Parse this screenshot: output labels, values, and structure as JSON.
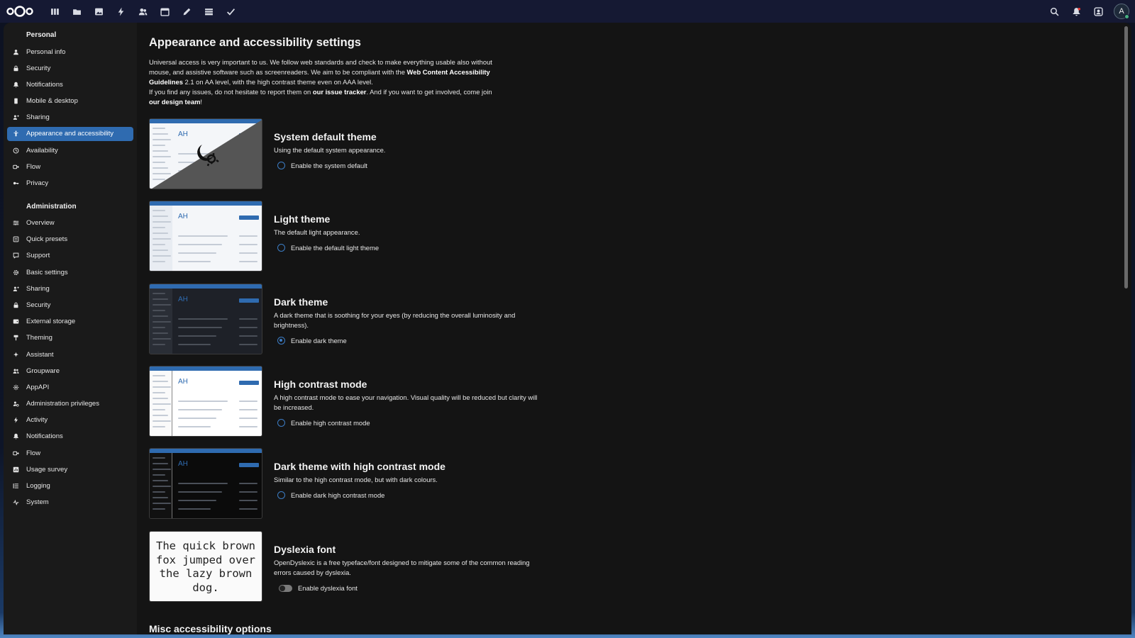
{
  "header": {
    "apps": [
      "dashboard-icon",
      "files-icon",
      "photos-icon",
      "activity-icon",
      "contacts-icon",
      "calendar-icon",
      "notes-icon",
      "deck-icon",
      "tasks-icon"
    ],
    "right_icons": [
      "search-icon",
      "notifications-icon",
      "contacts-menu-icon"
    ],
    "avatar_initial": "A"
  },
  "sidebar": {
    "personal_title": "Personal",
    "personal": [
      {
        "label": "Personal info",
        "icon": "user-icon"
      },
      {
        "label": "Security",
        "icon": "lock-icon"
      },
      {
        "label": "Notifications",
        "icon": "bell-icon"
      },
      {
        "label": "Mobile & desktop",
        "icon": "phone-icon"
      },
      {
        "label": "Sharing",
        "icon": "share-icon"
      },
      {
        "label": "Appearance and accessibility",
        "icon": "accessibility-icon",
        "active": true
      },
      {
        "label": "Availability",
        "icon": "clock-icon"
      },
      {
        "label": "Flow",
        "icon": "flow-icon"
      },
      {
        "label": "Privacy",
        "icon": "key-icon"
      }
    ],
    "admin_title": "Administration",
    "admin": [
      {
        "label": "Overview",
        "icon": "overview-icon"
      },
      {
        "label": "Quick presets",
        "icon": "presets-icon"
      },
      {
        "label": "Support",
        "icon": "support-icon"
      },
      {
        "label": "Basic settings",
        "icon": "gear-icon"
      },
      {
        "label": "Sharing",
        "icon": "share-icon"
      },
      {
        "label": "Security",
        "icon": "lock-icon"
      },
      {
        "label": "External storage",
        "icon": "storage-icon"
      },
      {
        "label": "Theming",
        "icon": "brush-icon"
      },
      {
        "label": "Assistant",
        "icon": "sparkle-icon"
      },
      {
        "label": "Groupware",
        "icon": "group-icon"
      },
      {
        "label": "AppAPI",
        "icon": "api-icon"
      },
      {
        "label": "Administration privileges",
        "icon": "admin-icon"
      },
      {
        "label": "Activity",
        "icon": "activity-icon"
      },
      {
        "label": "Notifications",
        "icon": "bell-icon"
      },
      {
        "label": "Flow",
        "icon": "flow-icon"
      },
      {
        "label": "Usage survey",
        "icon": "chart-icon"
      },
      {
        "label": "Logging",
        "icon": "list-icon"
      },
      {
        "label": "System",
        "icon": "pulse-icon"
      }
    ]
  },
  "main": {
    "title": "Appearance and accessibility settings",
    "intro": {
      "p1a": "Universal access is very important to us. We follow web standards and check to make everything usable also without mouse, and assistive software such as screenreaders. We aim to be compliant with the ",
      "p1_link": "Web Content Accessibility Guidelines",
      "p1b": " 2.1 on AA level, with the high contrast theme even on AAA level.",
      "p2a": "If you find any issues, do not hesitate to report them on ",
      "p2_link1": "our issue tracker",
      "p2b": ". And if you want to get involved, come join ",
      "p2_link2": "our design team",
      "p2c": "!"
    },
    "themes": [
      {
        "name": "System default theme",
        "desc": "Using the default system appearance.",
        "option": "Enable the system default",
        "selected": false,
        "thumb_text": "AH"
      },
      {
        "name": "Light theme",
        "desc": "The default light appearance.",
        "option": "Enable the default light theme",
        "selected": false,
        "thumb_text": "AH"
      },
      {
        "name": "Dark theme",
        "desc": "A dark theme that is soothing for your eyes (by reducing the overall luminosity and brightness).",
        "option": "Enable dark theme",
        "selected": true,
        "thumb_text": "AH"
      },
      {
        "name": "High contrast mode",
        "desc": "A high contrast mode to ease your navigation. Visual quality will be reduced but clarity will be increased.",
        "option": "Enable high contrast mode",
        "selected": false,
        "thumb_text": "AH"
      },
      {
        "name": "Dark theme with high contrast mode",
        "desc": "Similar to the high contrast mode, but with dark colours.",
        "option": "Enable dark high contrast mode",
        "selected": false,
        "thumb_text": "AH"
      }
    ],
    "dyslexia": {
      "preview": "The quick brown fox jumped over the lazy brown dog.",
      "name": "Dyslexia font",
      "desc": "OpenDyslexic is a free typeface/font designed to mitigate some of the common reading errors caused by dyslexia.",
      "option": "Enable dyslexia font",
      "enabled": false
    },
    "misc_title": "Misc accessibility options"
  },
  "colors": {
    "accent": "#2f6bb0",
    "header_bg": "#151933",
    "panel_bg": "#141414",
    "sidebar_bg": "#1a1a1a"
  }
}
